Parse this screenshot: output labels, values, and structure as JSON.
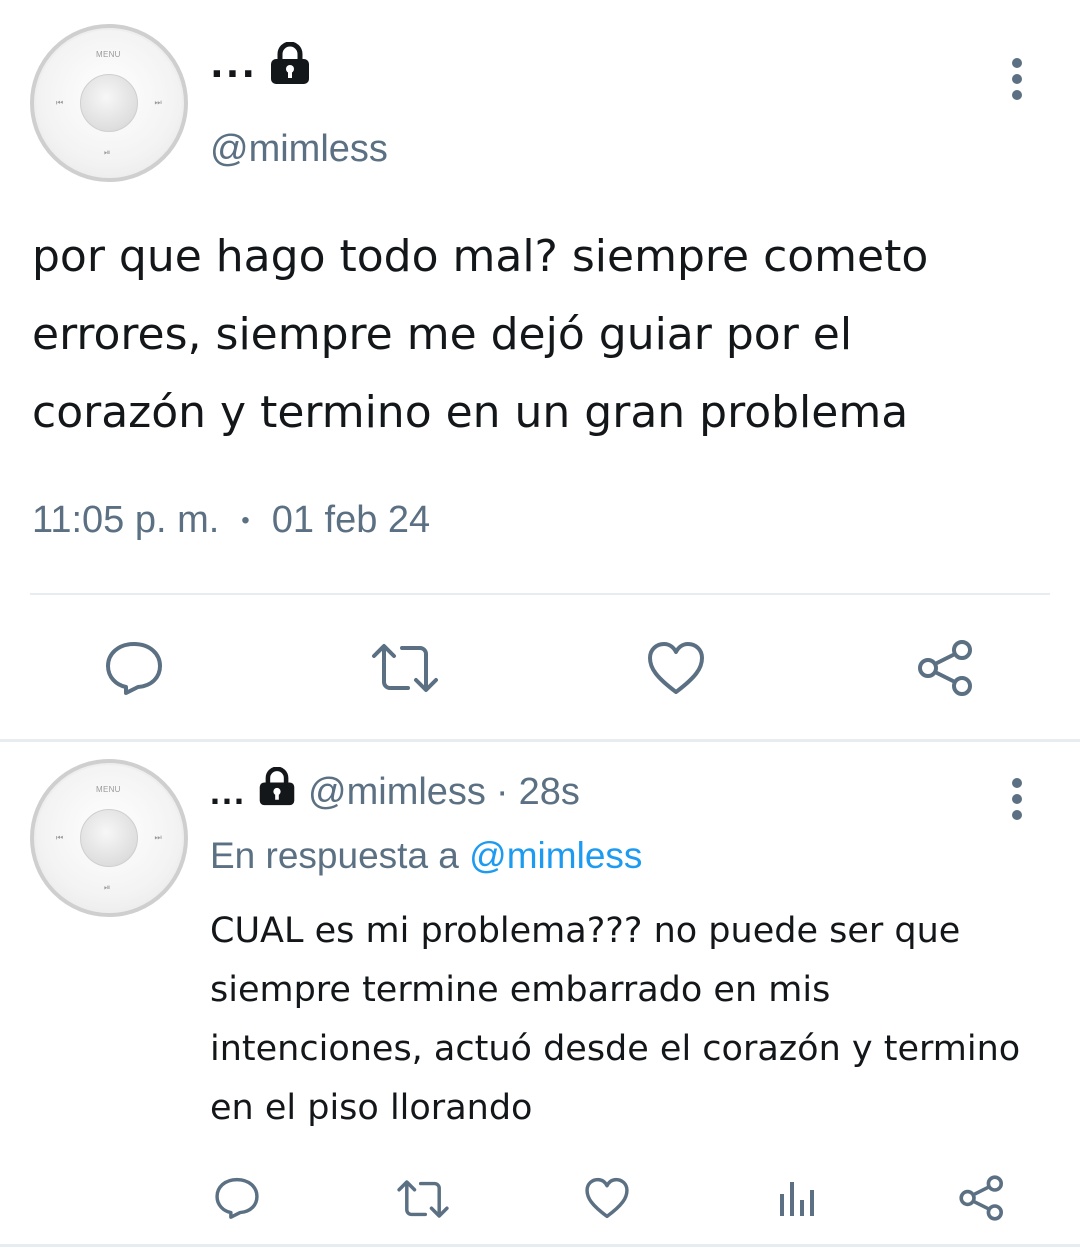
{
  "main_tweet": {
    "display_name": "...",
    "handle": "@mimless",
    "text": "por que hago todo mal? siempre cometo errores, siempre me dejó guiar por el corazón y termino en un gran problema",
    "time": "11:05 p. m.",
    "separator": "•",
    "date": "01 feb 24",
    "avatar_label": "MENU"
  },
  "reply_tweet": {
    "display_name": "...",
    "handle": "@mimless",
    "dot": "·",
    "age": "28s",
    "reply_to_prefix": "En respuesta a",
    "reply_to_handle": "@mimless",
    "text": "CUAL es mi problema??? no puede ser que siempre termine embarrado en mis intenciones, actuó desde el corazón y termino en el piso llorando",
    "avatar_label": "MENU"
  },
  "icons": {
    "lock": "lock-icon",
    "more": "more-vertical-icon",
    "reply": "reply-icon",
    "retweet": "retweet-icon",
    "like": "heart-icon",
    "share": "share-icon",
    "analytics": "analytics-icon"
  },
  "colors": {
    "text": "#14171a",
    "secondary": "#5b7083",
    "link": "#1d9bf0",
    "divider": "#e6ecf0"
  }
}
